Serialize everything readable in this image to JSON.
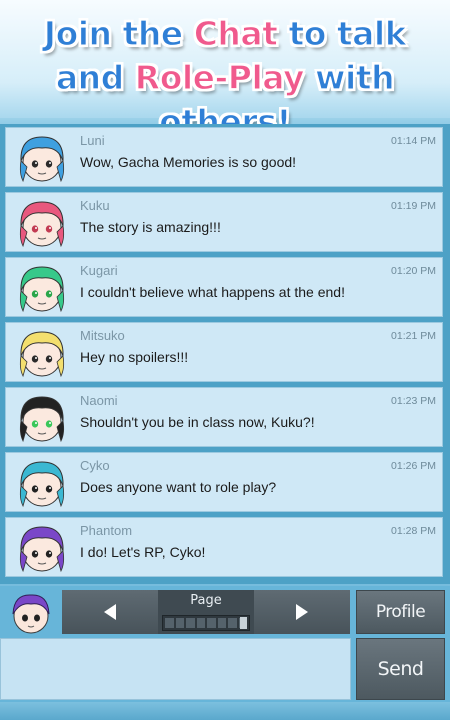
{
  "banner": {
    "line1": {
      "pre": "Join the ",
      "highlight": "Chat",
      "post": " to talk"
    },
    "line2": {
      "pre": "and ",
      "highlight": "Role-Play",
      "post": " with others!"
    }
  },
  "messages": [
    {
      "name": "Luni",
      "time": "01:14 PM",
      "text": "Wow, Gacha Memories is so good!",
      "hair": "#3fa0e0",
      "eyes": "#2b2b2b"
    },
    {
      "name": "Kuku",
      "time": "01:19 PM",
      "text": "The story is amazing!!!",
      "hair": "#e8587e",
      "eyes": "#c23b53"
    },
    {
      "name": "Kugari",
      "time": "01:20 PM",
      "text": "I couldn't believe what happens at the end!",
      "hair": "#37c98a",
      "eyes": "#2aa64a"
    },
    {
      "name": "Mitsuko",
      "time": "01:21 PM",
      "text": "Hey no spoilers!!!",
      "hair": "#f3df6e",
      "eyes": "#2b2b2b"
    },
    {
      "name": "Naomi",
      "time": "01:23 PM",
      "text": "Shouldn't you be in class now, Kuku?!",
      "hair": "#222222",
      "eyes": "#39c75a"
    },
    {
      "name": "Cyko",
      "time": "01:26 PM",
      "text": "Does anyone want to role play?",
      "hair": "#3bb8d2",
      "eyes": "#222222"
    },
    {
      "name": "Phantom",
      "time": "01:28 PM",
      "text": "I do! Let's RP, Cyko!",
      "hair": "#7a47c8",
      "eyes": "#222222"
    }
  ],
  "controls": {
    "page_label": "Page",
    "profile_label": "Profile",
    "send_label": "Send",
    "message_placeholder": ""
  },
  "icons": {
    "prev": "arrow-left-icon",
    "next": "arrow-right-icon"
  }
}
